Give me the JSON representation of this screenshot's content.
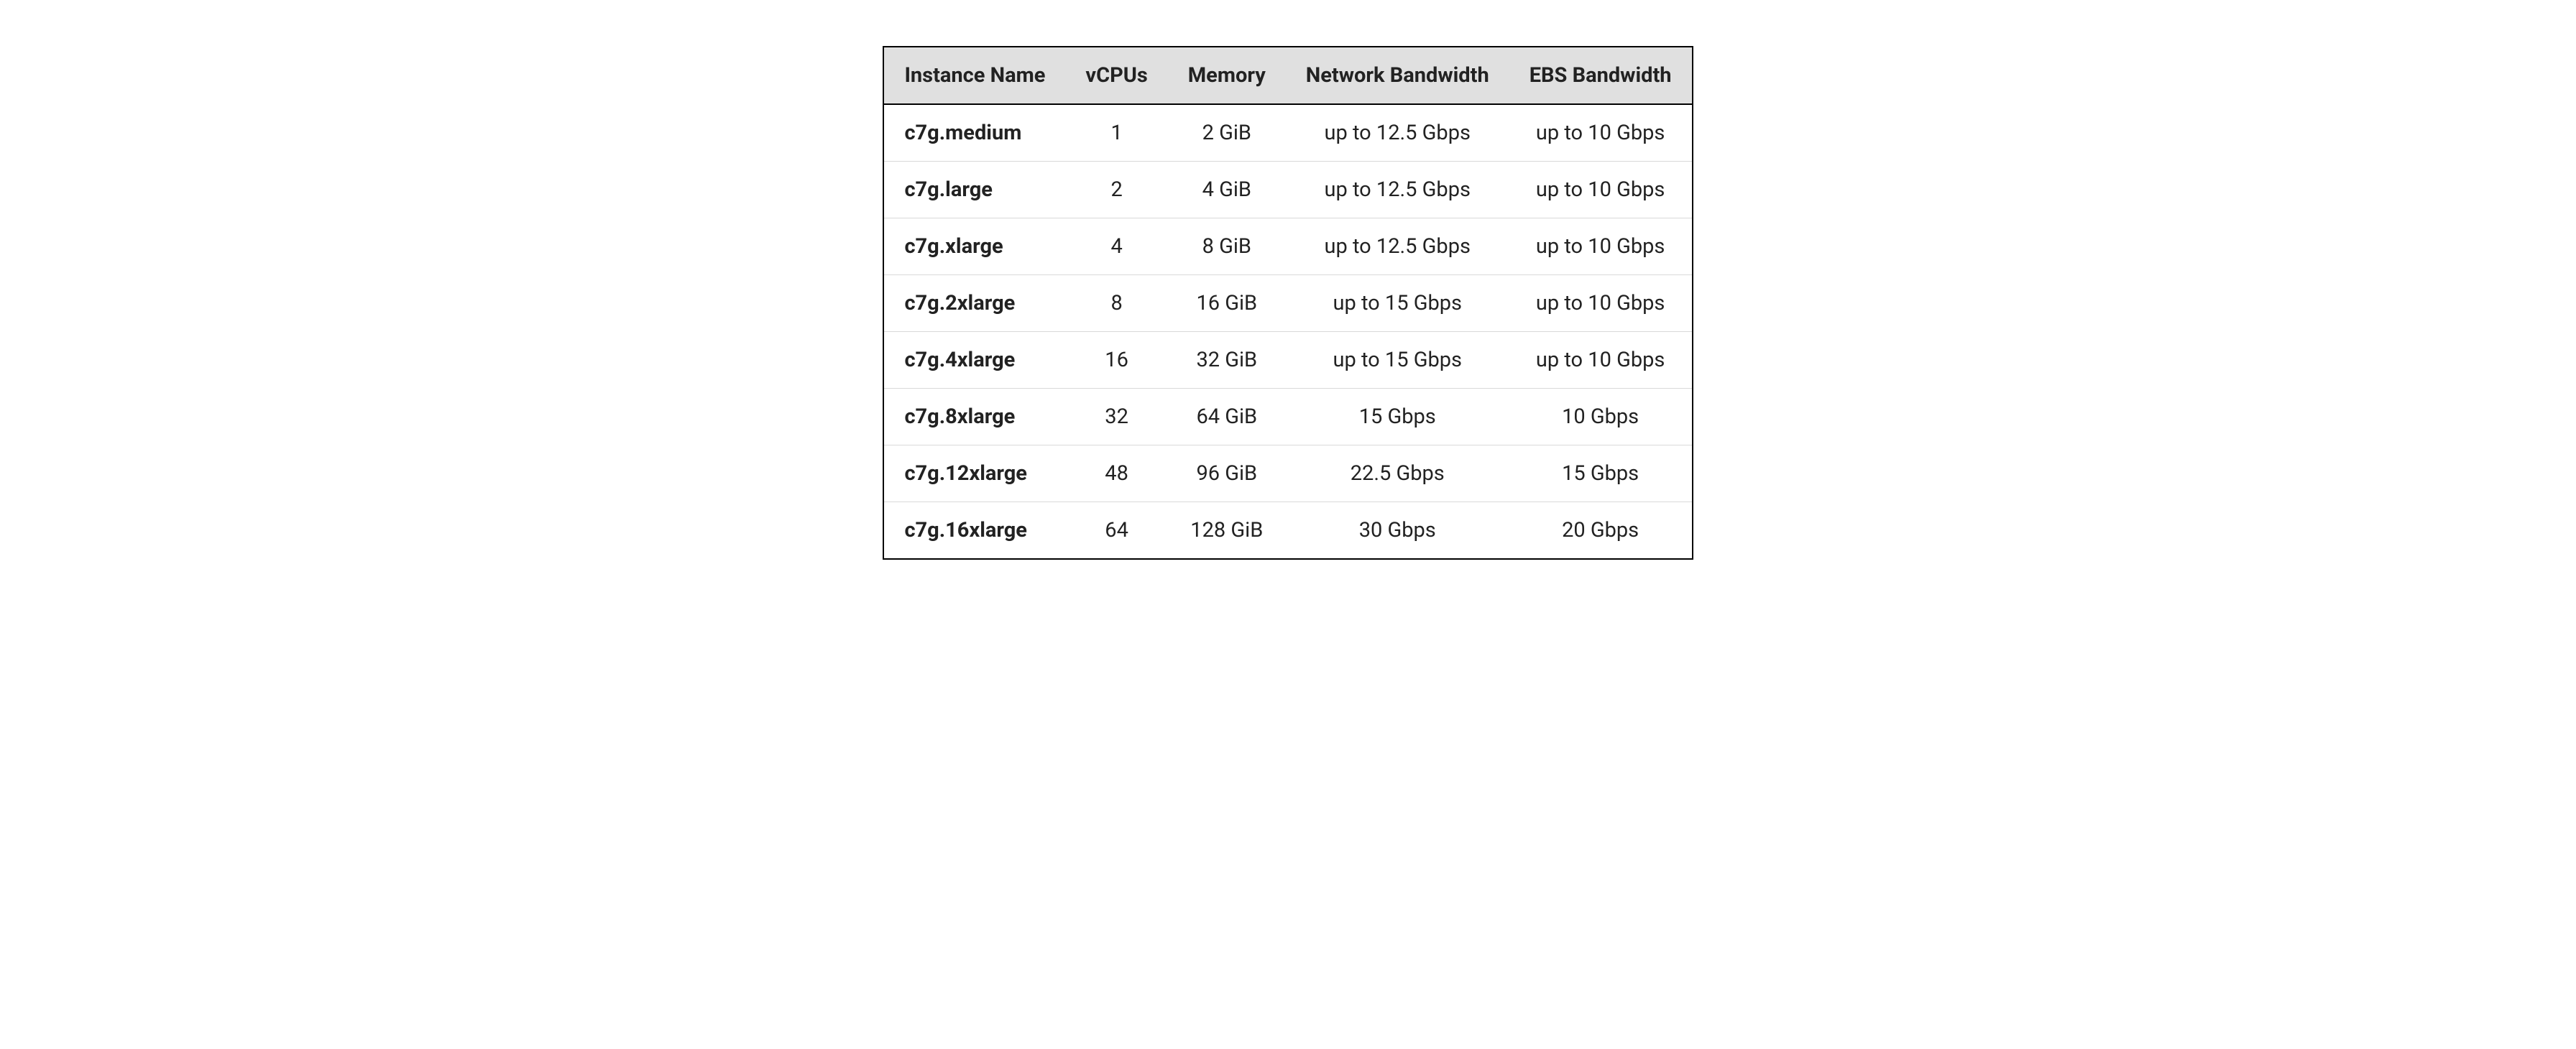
{
  "table": {
    "headers": {
      "instance": "Instance Name",
      "vcpus": "vCPUs",
      "memory": "Memory",
      "network": "Network Bandwidth",
      "ebs": "EBS Bandwidth"
    },
    "rows": [
      {
        "instance": "c7g.medium",
        "vcpus": "1",
        "memory": "2 GiB",
        "network": "up to 12.5 Gbps",
        "ebs": "up to 10 Gbps"
      },
      {
        "instance": "c7g.large",
        "vcpus": "2",
        "memory": "4 GiB",
        "network": "up to 12.5 Gbps",
        "ebs": "up to 10 Gbps"
      },
      {
        "instance": "c7g.xlarge",
        "vcpus": "4",
        "memory": "8 GiB",
        "network": "up to 12.5 Gbps",
        "ebs": "up to 10 Gbps"
      },
      {
        "instance": "c7g.2xlarge",
        "vcpus": "8",
        "memory": "16 GiB",
        "network": "up to 15 Gbps",
        "ebs": "up to 10 Gbps"
      },
      {
        "instance": "c7g.4xlarge",
        "vcpus": "16",
        "memory": "32 GiB",
        "network": "up to 15 Gbps",
        "ebs": "up to 10 Gbps"
      },
      {
        "instance": "c7g.8xlarge",
        "vcpus": "32",
        "memory": "64 GiB",
        "network": "15 Gbps",
        "ebs": "10 Gbps"
      },
      {
        "instance": "c7g.12xlarge",
        "vcpus": "48",
        "memory": "96 GiB",
        "network": "22.5 Gbps",
        "ebs": "15 Gbps"
      },
      {
        "instance": "c7g.16xlarge",
        "vcpus": "64",
        "memory": "128 GiB",
        "network": "30 Gbps",
        "ebs": "20 Gbps"
      }
    ]
  }
}
